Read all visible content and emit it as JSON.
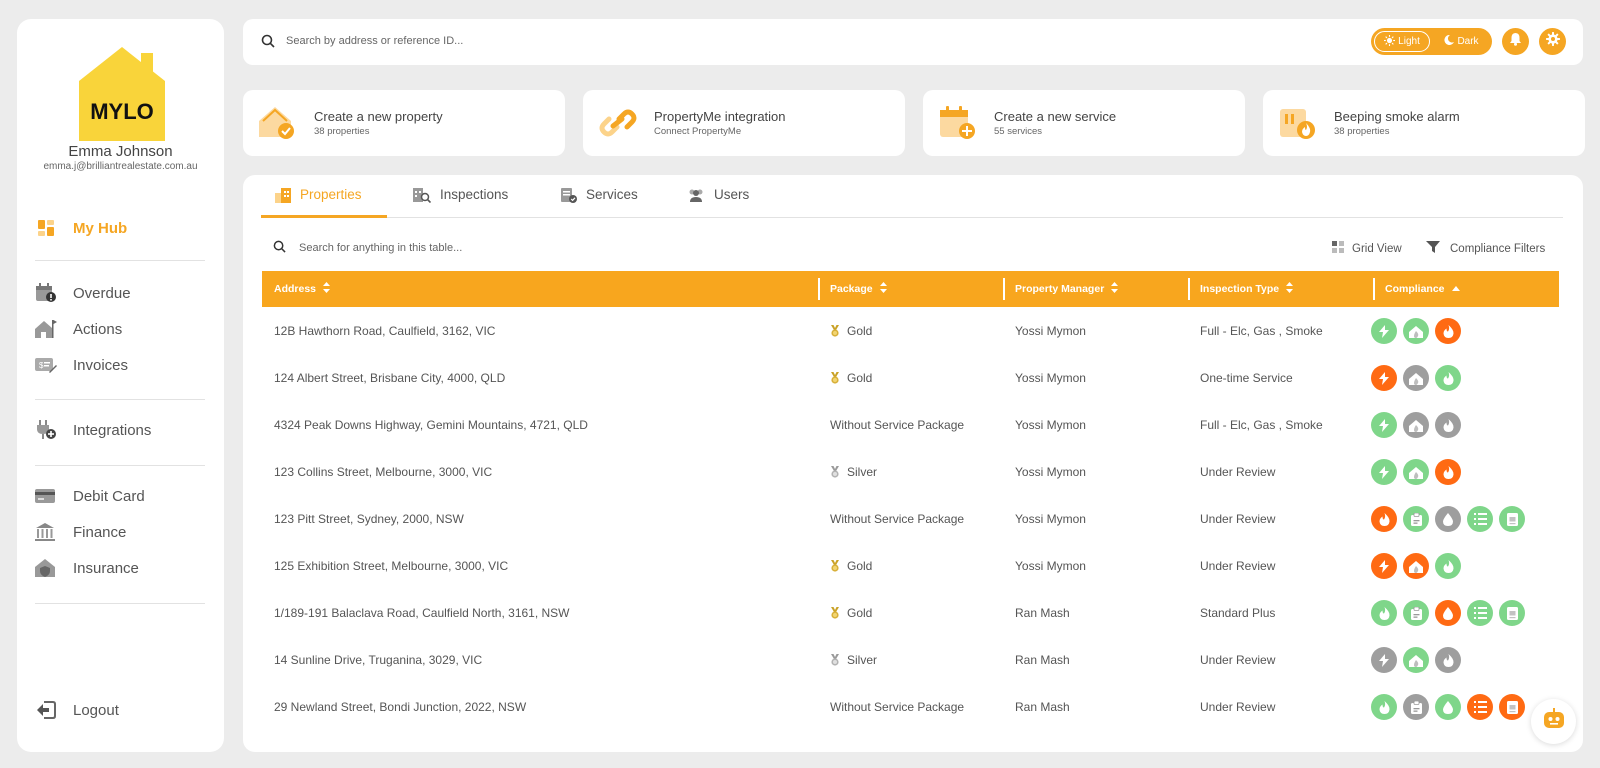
{
  "brand": {
    "logo_text": "MYLO",
    "accent": "#f5a623",
    "logo_color": "#f9d43a"
  },
  "user": {
    "name": "Emma Johnson",
    "email": "emma.j@brilliantrealestate.com.au"
  },
  "sidebar": {
    "hub": {
      "label": "My Hub",
      "icon": "dashboard-icon"
    },
    "group1": [
      {
        "label": "Overdue",
        "icon": "calendar-alert-icon"
      },
      {
        "label": "Actions",
        "icon": "house-flag-icon"
      },
      {
        "label": "Invoices",
        "icon": "invoice-icon"
      }
    ],
    "group2": [
      {
        "label": "Integrations",
        "icon": "plug-icon"
      }
    ],
    "group3": [
      {
        "label": "Debit Card",
        "icon": "credit-card-icon"
      },
      {
        "label": "Finance",
        "icon": "bank-icon"
      },
      {
        "label": "Insurance",
        "icon": "house-shield-icon"
      }
    ],
    "logout": {
      "label": "Logout",
      "icon": "logout-icon"
    }
  },
  "topbar": {
    "search_placeholder": "Search by address or reference ID...",
    "theme": {
      "light": "Light",
      "dark": "Dark",
      "selected": "Light"
    }
  },
  "quick_cards": [
    {
      "title": "Create a new property",
      "subtitle": "38 properties",
      "icon": "house-check-icon"
    },
    {
      "title": "PropertyMe integration",
      "subtitle": "Connect PropertyMe",
      "icon": "link-icon"
    },
    {
      "title": "Create a new service",
      "subtitle": "55 services",
      "icon": "calendar-plus-icon"
    },
    {
      "title": "Beeping smoke alarm",
      "subtitle": "38 properties",
      "icon": "smoke-alarm-icon"
    }
  ],
  "tabs": [
    {
      "label": "Properties",
      "active": true,
      "icon": "building-icon"
    },
    {
      "label": "Inspections",
      "active": false,
      "icon": "inspection-icon"
    },
    {
      "label": "Services",
      "active": false,
      "icon": "services-icon"
    },
    {
      "label": "Users",
      "active": false,
      "icon": "users-icon"
    }
  ],
  "table": {
    "search_placeholder": "Search for anything in this table...",
    "grid_view_label": "Grid View",
    "filters_label": "Compliance Filters",
    "columns": [
      "Address",
      "Package",
      "Property Manager",
      "Inspection Type",
      "Compliance"
    ],
    "rows": [
      {
        "address": "12B Hawthorn Road, Caulfield, 3162, VIC",
        "package": "Gold",
        "medal": "gold",
        "manager": "Yossi Mymon",
        "inspection": "Full - Elc, Gas , Smoke",
        "compliance": [
          {
            "type": "electrical",
            "status": "green"
          },
          {
            "type": "gas",
            "status": "green"
          },
          {
            "type": "smoke",
            "status": "orange"
          }
        ]
      },
      {
        "address": "124 Albert Street, Brisbane City, 4000, QLD",
        "package": "Gold",
        "medal": "gold",
        "manager": "Yossi Mymon",
        "inspection": "One-time Service",
        "compliance": [
          {
            "type": "electrical",
            "status": "orange"
          },
          {
            "type": "gas",
            "status": "grey"
          },
          {
            "type": "smoke",
            "status": "green"
          }
        ]
      },
      {
        "address": "4324 Peak Downs Highway, Gemini Mountains, 4721, QLD",
        "package": "Without Service Package",
        "medal": "",
        "manager": "Yossi Mymon",
        "inspection": "Full - Elc, Gas , Smoke",
        "compliance": [
          {
            "type": "electrical",
            "status": "green"
          },
          {
            "type": "gas",
            "status": "grey"
          },
          {
            "type": "smoke",
            "status": "grey"
          }
        ]
      },
      {
        "address": "123 Collins Street, Melbourne, 3000, VIC",
        "package": "Silver",
        "medal": "silver",
        "manager": "Yossi Mymon",
        "inspection": "Under Review",
        "compliance": [
          {
            "type": "electrical",
            "status": "green"
          },
          {
            "type": "gas",
            "status": "green"
          },
          {
            "type": "smoke",
            "status": "orange"
          }
        ]
      },
      {
        "address": "123 Pitt Street, Sydney, 2000, NSW",
        "package": "Without Service Package",
        "medal": "",
        "manager": "Yossi Mymon",
        "inspection": "Under Review",
        "compliance": [
          {
            "type": "smoke",
            "status": "orange"
          },
          {
            "type": "clipboard",
            "status": "green"
          },
          {
            "type": "water",
            "status": "grey"
          },
          {
            "type": "list",
            "status": "green"
          },
          {
            "type": "document",
            "status": "green"
          }
        ]
      },
      {
        "address": "125 Exhibition Street, Melbourne, 3000, VIC",
        "package": "Gold",
        "medal": "gold",
        "manager": "Yossi Mymon",
        "inspection": "Under Review",
        "compliance": [
          {
            "type": "electrical",
            "status": "orange"
          },
          {
            "type": "gas",
            "status": "orange"
          },
          {
            "type": "smoke",
            "status": "green"
          }
        ]
      },
      {
        "address": "1/189-191 Balaclava Road, Caulfield North, 3161, NSW",
        "package": "Gold",
        "medal": "gold",
        "manager": "Ran Mash",
        "inspection": "Standard Plus",
        "compliance": [
          {
            "type": "smoke",
            "status": "green"
          },
          {
            "type": "clipboard",
            "status": "green"
          },
          {
            "type": "water",
            "status": "orange"
          },
          {
            "type": "list",
            "status": "green"
          },
          {
            "type": "document",
            "status": "green"
          }
        ]
      },
      {
        "address": "14 Sunline Drive, Truganina, 3029, VIC",
        "package": "Silver",
        "medal": "silver",
        "manager": "Ran Mash",
        "inspection": "Under Review",
        "compliance": [
          {
            "type": "electrical",
            "status": "grey"
          },
          {
            "type": "gas",
            "status": "green"
          },
          {
            "type": "smoke",
            "status": "grey"
          }
        ]
      },
      {
        "address": "29 Newland Street, Bondi Junction, 2022, NSW",
        "package": "Without Service Package",
        "medal": "",
        "manager": "Ran Mash",
        "inspection": "Under Review",
        "compliance": [
          {
            "type": "smoke",
            "status": "green"
          },
          {
            "type": "clipboard",
            "status": "grey"
          },
          {
            "type": "water",
            "status": "green"
          },
          {
            "type": "list",
            "status": "orange"
          },
          {
            "type": "document",
            "status": "orange"
          }
        ]
      }
    ]
  }
}
